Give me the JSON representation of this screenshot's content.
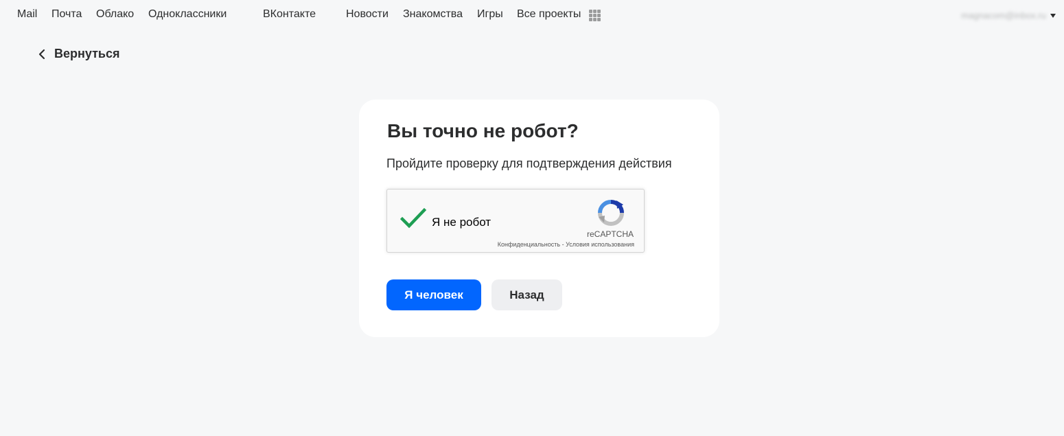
{
  "topnav": {
    "links": [
      "Mail",
      "Почта",
      "Облако",
      "Одноклассники",
      "ВКонтакте",
      "Новости",
      "Знакомства",
      "Игры",
      "Все проекты"
    ],
    "apps_icon": "grid-icon",
    "account_email": "magnacom@inbox.ru"
  },
  "back": {
    "label": "Вернуться",
    "icon": "chevron-left-icon"
  },
  "card": {
    "title": "Вы точно не робот?",
    "subtitle": "Пройдите проверку для подтверждения действия",
    "recaptcha": {
      "checked": true,
      "label": "Я не робот",
      "brand": "reCAPTCHA",
      "privacy": "Конфиденциальность",
      "separator": " - ",
      "terms": "Условия использования",
      "check_color": "#1e9e53"
    },
    "primary_button": "Я человек",
    "secondary_button": "Назад"
  },
  "colors": {
    "background": "#f6f7f8",
    "primary": "#0266fe",
    "secondary": "#eeeff1",
    "text": "#2c2d2e"
  }
}
